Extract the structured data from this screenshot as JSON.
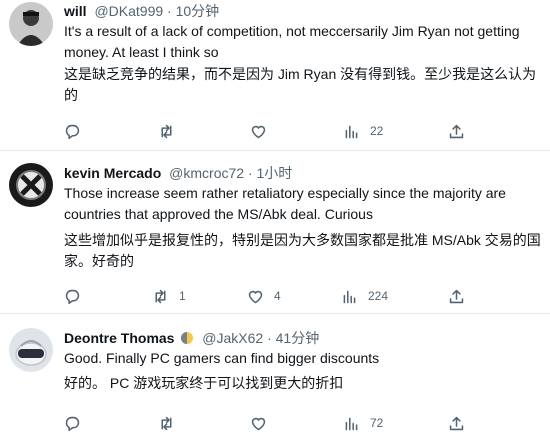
{
  "tweets": [
    {
      "name": "will",
      "handle": "@DKat999",
      "dot": "·",
      "time": "10分钟",
      "text_en": "It's a result of a lack of competition, not meccersarily Jim Ryan not getting money. At least I think so",
      "text_cn": "这是缺乏竞争的结果，而不是因为 Jim Ryan 没有得到钱。至少我是这么认为的",
      "counts": {
        "reply": "",
        "retweet": "",
        "like": "",
        "views": "22"
      }
    },
    {
      "name": "kevin Mercado",
      "handle": "@kmcroc72",
      "dot": "·",
      "time": "1小时",
      "text_en": "Those increase seem rather retaliatory especially since the majority are countries that approved the MS/Abk deal. Curious",
      "text_cn": "这些增加似乎是报复性的，特别是因为大多数国家都是批准 MS/Abk 交易的国家。好奇的",
      "counts": {
        "reply": "",
        "retweet": "1",
        "like": "4",
        "views": "224"
      }
    },
    {
      "name": "Deontre Thomas",
      "handle": "@JakX62",
      "dot": "·",
      "time": "41分钟",
      "text_en": "Good. Finally PC gamers can find bigger discounts",
      "text_cn": "好的。 PC 游戏玩家终于可以找到更大的折扣",
      "counts": {
        "reply": "",
        "retweet": "",
        "like": "",
        "views": "72"
      }
    }
  ],
  "icons": {
    "reply": "reply-icon",
    "retweet": "retweet-icon",
    "like": "like-icon",
    "views": "views-icon",
    "share": "share-icon"
  },
  "colors": {
    "text": "#0f1419",
    "secondary": "#536471",
    "divider": "#e6e9eb"
  }
}
